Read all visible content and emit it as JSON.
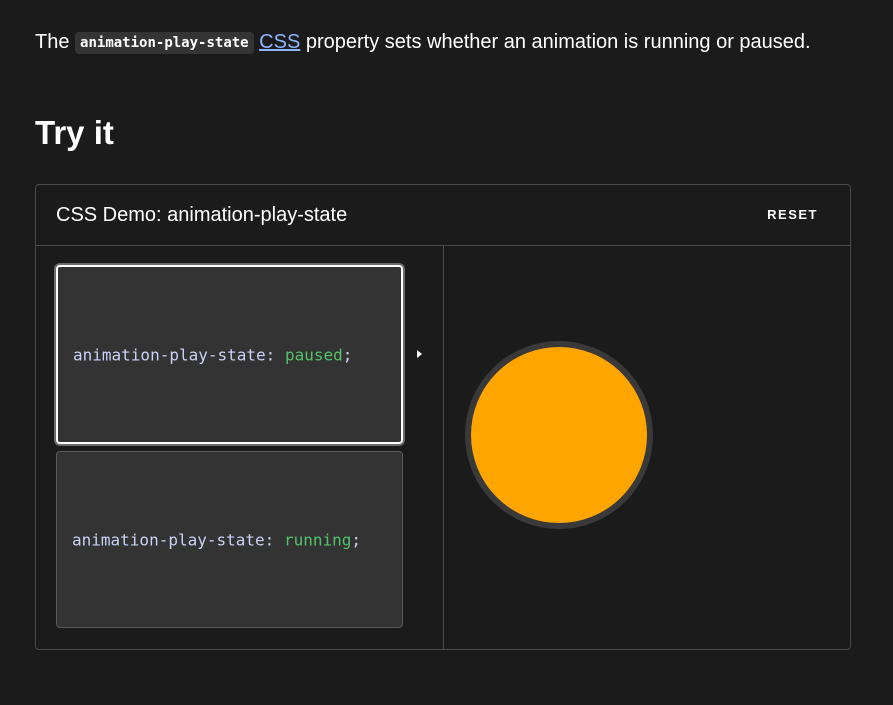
{
  "intro": {
    "prefix": "The",
    "property": "animation-play-state",
    "link": "CSS",
    "suffix": "property sets whether an animation is running or paused."
  },
  "heading": "Try it",
  "demo": {
    "title": "CSS Demo: animation-play-state",
    "reset_label": "RESET",
    "choices": [
      {
        "property": "animation-play-state",
        "colon": ":",
        "value": "paused",
        "semicolon": ";",
        "selected": true
      },
      {
        "property": "animation-play-state",
        "colon": ":",
        "value": "running",
        "semicolon": ";",
        "selected": false
      }
    ],
    "ball_color": "#ffa500"
  },
  "colors": {
    "background": "#1b1b1b",
    "link": "#8cb4ff",
    "code_value": "#53c26b",
    "code_property": "#c8d2f5"
  },
  "icons": {
    "play": "play-triangle"
  }
}
